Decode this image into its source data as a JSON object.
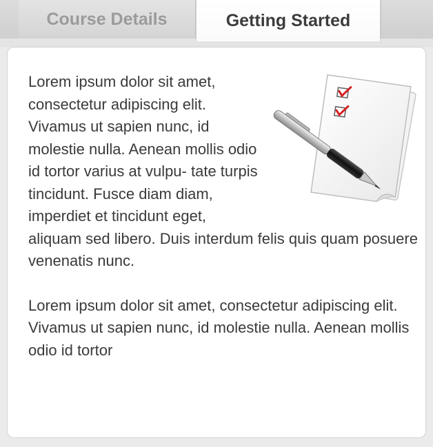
{
  "tabs": [
    {
      "label": "Course Details",
      "active": false
    },
    {
      "label": "Getting Started",
      "active": true
    }
  ],
  "content": {
    "paragraph_1": "Lorem ipsum dolor sit amet, consectetur adipiscing elit. Vivamus ut sapien nunc, id molestie nulla. Aenean mollis odio id tortor varius at vulpu- tate turpis tincidunt. Fusce diam diam, imperdiet et tincidunt eget, aliquam sed libero. Duis interdum felis quis quam posuere venenatis nunc.",
    "paragraph_2": "Lorem ipsum dolor sit amet, consectetur adipiscing elit. Vivamus ut sapien nunc, id molestie nulla. Aenean mollis odio id tortor",
    "illustration_icon": "checklist-with-pen-icon"
  },
  "colors": {
    "page_background": "#ebebeb",
    "panel_background": "#ffffff",
    "text": "#3a3a3a",
    "inactive_tab_text": "#9b9b9b",
    "active_tab_text": "#3c3c3c",
    "checkmark": "#d62020"
  }
}
